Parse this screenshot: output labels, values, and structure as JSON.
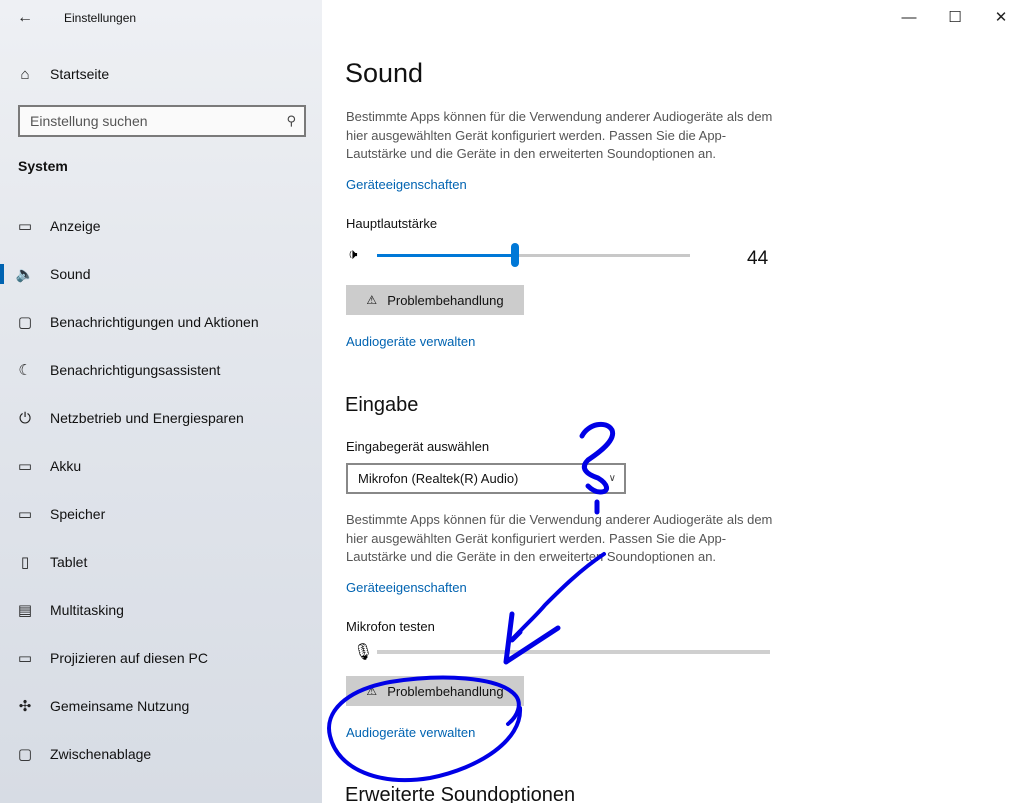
{
  "window": {
    "title": "Einstellungen",
    "minimize_glyph": "—",
    "maximize_glyph": "☐",
    "close_glyph": "✕"
  },
  "sidebar": {
    "home_label": "Startseite",
    "search_placeholder": "Einstellung suchen",
    "section_title": "System",
    "items": [
      {
        "label": "Anzeige",
        "icon": "display-icon",
        "glyph": "▭"
      },
      {
        "label": "Sound",
        "icon": "speaker-icon",
        "glyph": "🔈"
      },
      {
        "label": "Benachrichtigungen und Aktionen",
        "icon": "notification-icon",
        "glyph": "▢"
      },
      {
        "label": "Benachrichtigungsassistent",
        "icon": "moon-icon",
        "glyph": "☾"
      },
      {
        "label": "Netzbetrieb und Energiesparen",
        "icon": "power-icon",
        "glyph": "⏻"
      },
      {
        "label": "Akku",
        "icon": "battery-icon",
        "glyph": "▭"
      },
      {
        "label": "Speicher",
        "icon": "storage-icon",
        "glyph": "▭"
      },
      {
        "label": "Tablet",
        "icon": "tablet-icon",
        "glyph": "▯"
      },
      {
        "label": "Multitasking",
        "icon": "multitasking-icon",
        "glyph": "▤"
      },
      {
        "label": "Projizieren auf diesen PC",
        "icon": "project-icon",
        "glyph": "▭"
      },
      {
        "label": "Gemeinsame Nutzung",
        "icon": "share-icon",
        "glyph": "✣"
      },
      {
        "label": "Zwischenablage",
        "icon": "clipboard-icon",
        "glyph": "▢"
      }
    ],
    "active_index": 1
  },
  "main": {
    "title": "Sound",
    "output_desc": "Bestimmte Apps können für die Verwendung anderer Audiogeräte als dem hier ausgewählten Gerät konfiguriert werden. Passen Sie die App-Lautstärke und die Geräte in den erweiterten Soundoptionen an.",
    "device_props_link": "Geräteeigenschaften",
    "volume_label": "Hauptlautstärke",
    "volume_value": "44",
    "volume_level": 0.44,
    "troubleshoot_label": "Problembehandlung",
    "manage_devices_link": "Audiogeräte verwalten",
    "input_heading": "Eingabe",
    "input_select_label": "Eingabegerät auswählen",
    "input_device": "Mikrofon (Realtek(R) Audio)",
    "input_desc": "Bestimmte Apps können für die Verwendung anderer Audiogeräte als dem hier ausgewählten Gerät konfiguriert werden. Passen Sie die App-Lautstärke und die Geräte in den erweiterten Soundoptionen an.",
    "input_device_props_link": "Geräteeigenschaften",
    "mic_test_label": "Mikrofon testen",
    "input_troubleshoot_label": "Problembehandlung",
    "input_manage_devices_link": "Audiogeräte verwalten",
    "advanced_heading": "Erweiterte Soundoptionen"
  },
  "colors": {
    "accent": "#0078d7",
    "link": "#0063b1",
    "annotation": "#0000e6"
  }
}
